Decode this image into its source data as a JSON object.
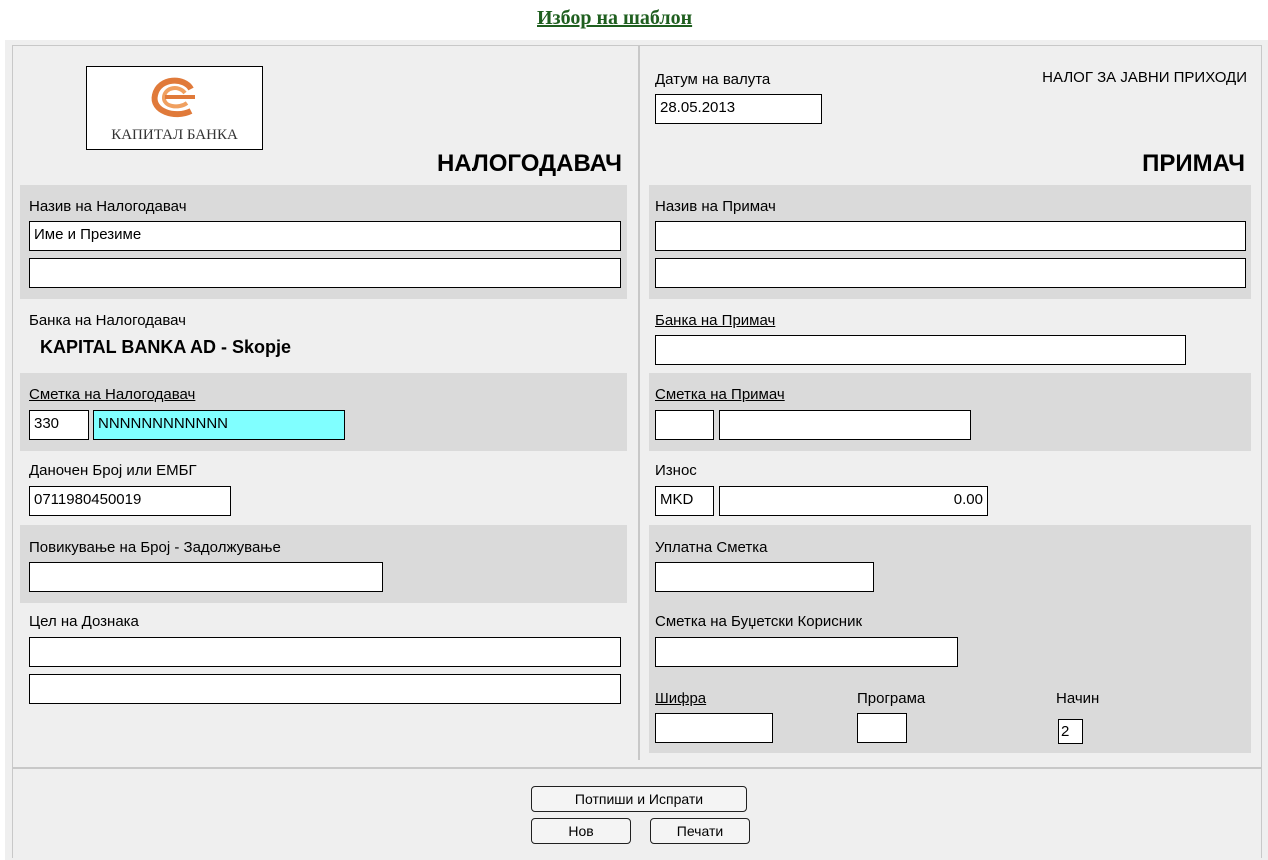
{
  "header": {
    "template_link": "Избор на шаблон"
  },
  "left": {
    "logo_text": "КАПИТАЛ БАНКА",
    "heading": "НАЛОГОДАВАЧ",
    "payer_name_label": "Назив на Налогодавач",
    "payer_name_value_1": "Име и Презиме",
    "payer_name_value_2": "",
    "payer_bank_label": "Банка на Налогодавач",
    "payer_bank_value": "KAPITAL BANKA AD - Skopje",
    "payer_account_label": "Сметка на Налогодавач",
    "payer_account_prefix": "330",
    "payer_account_number": "NNNNNNNNNNNN",
    "tax_id_label": "Даночен Број или ЕМБГ",
    "tax_id_value": "0711980450019",
    "debit_ref_label": "Повикување на Број - Задолжување",
    "debit_ref_value": "",
    "purpose_label": "Цел на Дознака",
    "purpose_value_1": "",
    "purpose_value_2": ""
  },
  "right": {
    "value_date_label": "Датум на валута",
    "value_date_value": "28.05.2013",
    "order_type": "НАЛОГ ЗА ЈАВНИ ПРИХОДИ",
    "heading": "ПРИМАЧ",
    "recipient_name_label": "Назив на Примач",
    "recipient_name_value_1": "",
    "recipient_name_value_2": "",
    "recipient_bank_label": "Банка на Примач",
    "recipient_bank_value": "",
    "recipient_account_label": "Сметка на Примач",
    "recipient_account_prefix": "",
    "recipient_account_number": "",
    "amount_label": "Износ",
    "currency": "MKD",
    "amount_value": "0.00",
    "payment_account_label": "Уплатна Сметка",
    "payment_account_value": "",
    "budget_account_label": "Сметка на Буџетски Корисник",
    "budget_account_value": "",
    "code_label": "Шифра",
    "code_value": "",
    "program_label": "Програма",
    "program_value": "",
    "method_label": "Начин",
    "method_value": "2"
  },
  "buttons": {
    "sign_send": "Потпиши и Испрати",
    "new": "Нов",
    "print": "Печати"
  },
  "colors": {
    "link": "#1f5f1f",
    "highlight_field": "#80ffff",
    "shade": "#dadada",
    "panel": "#efefef"
  }
}
